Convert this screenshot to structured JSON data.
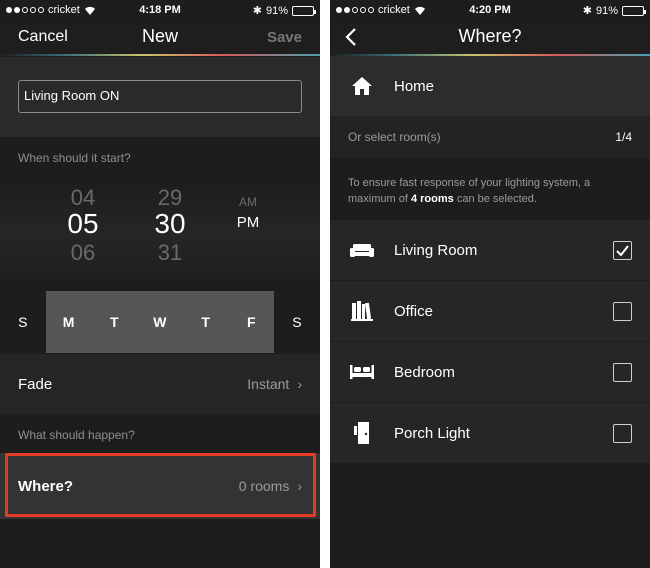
{
  "left": {
    "status": {
      "carrier": "cricket",
      "time": "4:18 PM",
      "battery": "91%",
      "battery_level": 0.91
    },
    "nav": {
      "cancel": "Cancel",
      "title": "New",
      "save": "Save"
    },
    "name_value": "Living Room ON",
    "start_label": "When should it start?",
    "picker": {
      "hours": {
        "above": "04",
        "selected": "05",
        "below": "06"
      },
      "minutes": {
        "above": "29",
        "selected": "30",
        "below": "31"
      },
      "ampm": {
        "above": "AM",
        "selected": "PM"
      }
    },
    "days": [
      {
        "label": "S",
        "active": false
      },
      {
        "label": "M",
        "active": true
      },
      {
        "label": "T",
        "active": true
      },
      {
        "label": "W",
        "active": true
      },
      {
        "label": "T",
        "active": true
      },
      {
        "label": "F",
        "active": true
      },
      {
        "label": "S",
        "active": false
      }
    ],
    "fade": {
      "label": "Fade",
      "value": "Instant"
    },
    "happen_label": "What should happen?",
    "where": {
      "label": "Where?",
      "value": "0 rooms"
    }
  },
  "right": {
    "status": {
      "carrier": "cricket",
      "time": "4:20 PM",
      "battery": "91%",
      "battery_level": 0.91
    },
    "nav": {
      "title": "Where?"
    },
    "home": {
      "label": "Home",
      "icon": "home-icon"
    },
    "select_label": "Or select room(s)",
    "select_count": "1/4",
    "note": {
      "before": "To ensure fast response of your lighting system, a maximum of ",
      "bold": "4 rooms",
      "after": " can be selected."
    },
    "rooms": [
      {
        "label": "Living Room",
        "icon": "sofa-icon",
        "checked": true
      },
      {
        "label": "Office",
        "icon": "books-icon",
        "checked": false
      },
      {
        "label": "Bedroom",
        "icon": "bed-icon",
        "checked": false
      },
      {
        "label": "Porch Light",
        "icon": "door-icon",
        "checked": false
      }
    ]
  },
  "colors": {
    "highlight": "#e23d24",
    "background": "#1d1d1d"
  }
}
